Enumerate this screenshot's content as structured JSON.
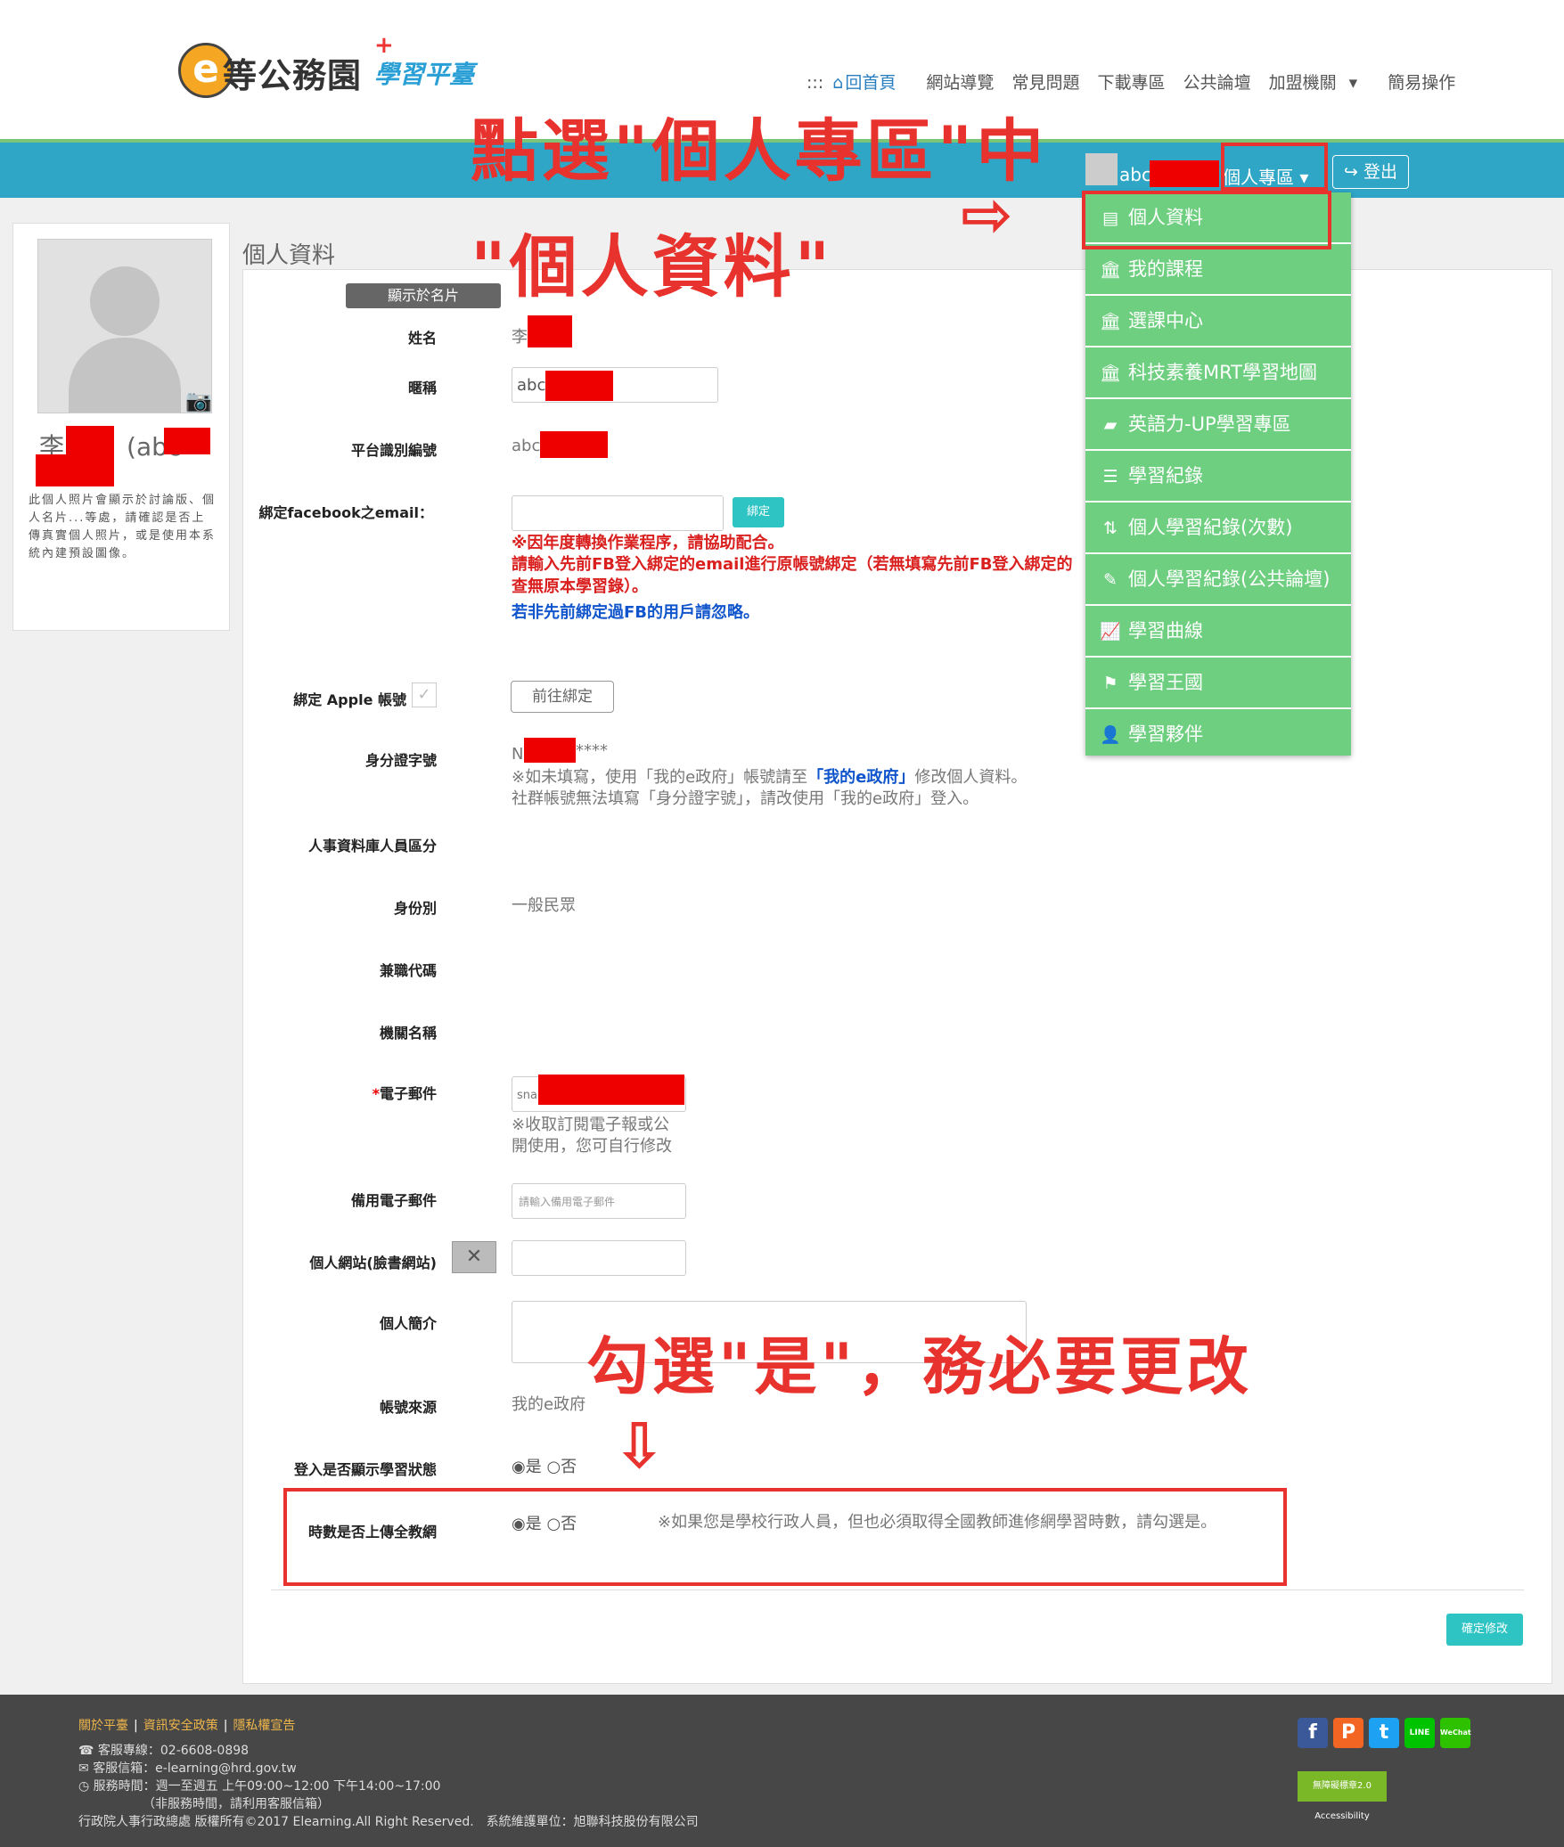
{
  "header": {
    "logo_badge": "e",
    "logo_main": "等公務園",
    "logo_plus": "+",
    "logo_sub": "學習平臺",
    "nav": {
      "prefix": ":::",
      "home": "回首頁",
      "items": [
        "網站導覽",
        "常見問題",
        "下載專區",
        "公共論壇",
        "加盟機關",
        "簡易操作"
      ]
    },
    "user": {
      "username": "abc",
      "personal_zone": "個人專區",
      "logout": "登出"
    }
  },
  "annotations": {
    "top_line1": "點選\"個人專區\"中",
    "top_line2": "\"個人資料\"",
    "bottom": "勾選\"是\"，務必要更改",
    "arrow_right": "⇨",
    "arrow_down": "⇩"
  },
  "menu": {
    "items": [
      {
        "label": "個人資料",
        "icon": "id-card-icon"
      },
      {
        "label": "我的課程",
        "icon": "institution-icon"
      },
      {
        "label": "選課中心",
        "icon": "institution-icon"
      },
      {
        "label": "科技素養MRT學習地圖",
        "icon": "institution-icon"
      },
      {
        "label": "英語力-UP學習專區",
        "icon": "book-icon"
      },
      {
        "label": "學習紀錄",
        "icon": "database-icon"
      },
      {
        "label": "個人學習紀錄(次數)",
        "icon": "sort-numeric-icon"
      },
      {
        "label": "個人學習紀錄(公共論壇)",
        "icon": "forum-icon"
      },
      {
        "label": "學習曲線",
        "icon": "line-chart-icon"
      },
      {
        "label": "學習王國",
        "icon": "flag-icon"
      },
      {
        "label": "學習夥伴",
        "icon": "user-plus-icon"
      }
    ]
  },
  "sidebar": {
    "name_prefix": "李",
    "name_mid": "(abc",
    "note": "此個人照片會顯示於討論版、個人名片...等處，請確認是否上傳真實個人照片，或是使用本系統內建預設圖像。"
  },
  "main": {
    "page_title": "個人資料",
    "card_label": "顯示於名片",
    "fields": {
      "name_label": "姓名",
      "name_value": "李",
      "nickname_label": "暱稱",
      "nickname_value": "abc",
      "platform_id_label": "平台識別編號",
      "platform_id_value": "abc",
      "facebook_label": "綁定facebook之email：",
      "bind_button": "綁定",
      "fb_note_line1": "※因年度轉換作業程序，請協助配合。",
      "fb_note_line2": "請輸入先前FB登入綁定的email進行原帳號綁定（若無填寫先前FB登入綁定的",
      "fb_note_line3": "查無原本學習錄）。",
      "fb_note_blue": "若非先前綁定過FB的用戶請忽略。",
      "apple_label": "綁定 Apple 帳號",
      "apple_button": "前往綁定",
      "id_label": "身分證字號",
      "id_value_prefix": "N",
      "id_value_suffix": "****",
      "id_note_a": "※如未填寫，使用「我的e政府」帳號請至",
      "id_note_link": "「我的e政府」",
      "id_note_b": "修改個人資料。",
      "id_note_line2": "社群帳號無法填寫「身分證字號」，請改使用「我的e政府」登入。",
      "hr_db_label": "人事資料庫人員區分",
      "identity_label": "身份別",
      "identity_value": "一般民眾",
      "parttime_label": "兼職代碼",
      "org_label": "機關名稱",
      "email_required": "*",
      "email_label": "電子郵件",
      "email_value": "sna",
      "email_note_line1": "※收取訂閱電子報或公",
      "email_note_line2": "開使用，您可自行修改",
      "backup_email_label": "備用電子郵件",
      "backup_email_placeholder": "請輸入備用電子郵件",
      "website_label": "個人網站(臉書網站)",
      "website_clear": "✕",
      "bio_label": "個人簡介",
      "source_label": "帳號來源",
      "source_value": "我的e政府",
      "show_status_label": "登入是否顯示學習狀態",
      "upload_label": "時數是否上傳全教網",
      "radio_yes": "是",
      "radio_no": "否",
      "upload_note": "※如果您是學校行政人員，但也必須取得全國教師進修網學習時數，請勾選是。"
    },
    "confirm_button": "確定修改"
  },
  "footer": {
    "links": [
      "關於平臺",
      "資訊安全政策",
      "隱私權宣告"
    ],
    "separator": "|",
    "phone": "客服專線：02-6608-0898",
    "email": "客服信箱：e-learning@hrd.gov.tw",
    "hours": "服務時間：週一至週五 上午09:00~12:00 下午14:00~17:00",
    "hours_note": "（非服務時間，請利用客服信箱）",
    "copyright": "行政院人事行政總處 版權所有©2017 Elearning.All Right Reserved.　系統維護單位：旭聯科技股份有限公司",
    "social": [
      "f",
      "P",
      "t",
      "LINE",
      "WeChat"
    ],
    "accessibility": "無障礙標章2.0 Accessibility"
  }
}
